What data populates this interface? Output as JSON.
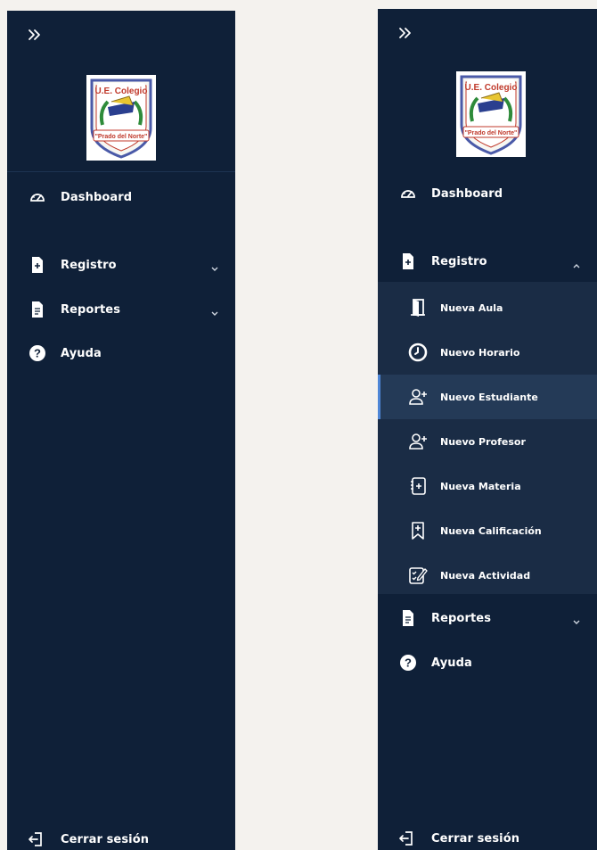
{
  "colors": {
    "sidebar_bg": "#0f2038",
    "submenu_bg": "#1a2c45",
    "active_bg": "#243a57",
    "active_accent": "#4e86d6",
    "page_bg": "#f4f2ee",
    "text": "#ffffff"
  },
  "logo": {
    "line1": "U.E. Colegio",
    "line2": "\"Prado del Norte\""
  },
  "collapsed_sidebar": {
    "state": "collapsed-submenus",
    "items": [
      {
        "label": "Dashboard",
        "icon": "gauge-icon"
      },
      {
        "label": "Registro",
        "icon": "file-plus-icon",
        "has_children": true,
        "expanded": false
      },
      {
        "label": "Reportes",
        "icon": "document-icon",
        "has_children": true,
        "expanded": false
      },
      {
        "label": "Ayuda",
        "icon": "help-circle-icon"
      }
    ],
    "logout": {
      "label": "Cerrar sesión",
      "icon": "logout-icon"
    }
  },
  "expanded_sidebar": {
    "state": "registro-expanded",
    "items": [
      {
        "label": "Dashboard",
        "icon": "gauge-icon"
      },
      {
        "label": "Registro",
        "icon": "file-plus-icon",
        "has_children": true,
        "expanded": true
      },
      {
        "label": "Reportes",
        "icon": "document-icon",
        "has_children": true,
        "expanded": false
      },
      {
        "label": "Ayuda",
        "icon": "help-circle-icon"
      }
    ],
    "registro_children": [
      {
        "label": "Nueva Aula",
        "icon": "door-icon",
        "active": false
      },
      {
        "label": "Nuevo Horario",
        "icon": "clock-icon",
        "active": false
      },
      {
        "label": "Nuevo Estudiante",
        "icon": "user-plus-icon",
        "active": true
      },
      {
        "label": "Nuevo Profesor",
        "icon": "user-plus-icon",
        "active": false
      },
      {
        "label": "Nueva Materia",
        "icon": "notebook-plus-icon",
        "active": false
      },
      {
        "label": "Nueva Calificación",
        "icon": "bookmark-plus-icon",
        "active": false
      },
      {
        "label": "Nueva Actividad",
        "icon": "checklist-edit-icon",
        "active": false
      }
    ],
    "logout": {
      "label": "Cerrar sesión",
      "icon": "logout-icon"
    }
  }
}
